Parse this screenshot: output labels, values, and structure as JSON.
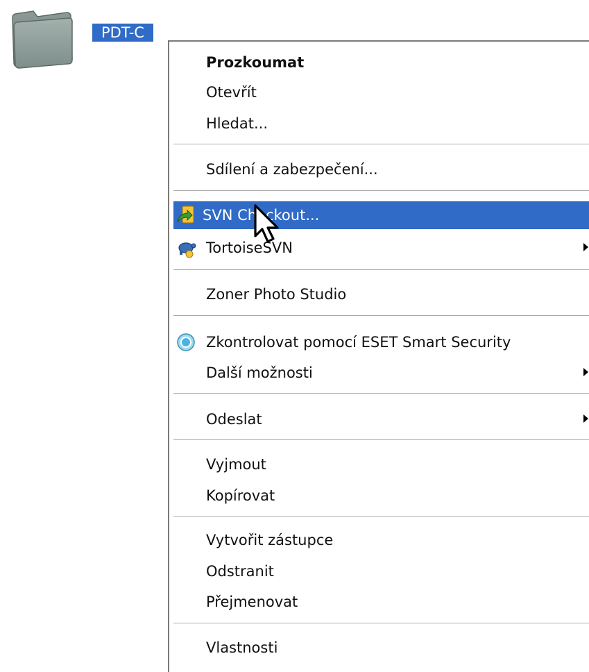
{
  "desktop": {
    "folder_icon": "folder-icon",
    "folder_name": "PDT-C",
    "selection_color": "#2f6bc7"
  },
  "menu": {
    "highlight_color": "#2f6bc7",
    "items": [
      {
        "label": "Prozkoumat",
        "bold": true
      },
      {
        "label": "Otevřít"
      },
      {
        "label": "Hledat..."
      },
      {
        "label": "Sdílení a zabezpečení..."
      },
      {
        "label": "SVN Checkout...",
        "icon": "svn-checkout-icon",
        "highlighted": true
      },
      {
        "label": "TortoiseSVN",
        "icon": "tortoisesvn-icon",
        "submenu": true
      },
      {
        "label": "Zoner Photo Studio"
      },
      {
        "label": "Zkontrolovat pomocí ESET Smart Security",
        "icon": "eset-icon"
      },
      {
        "label": "Další možnosti",
        "submenu": true
      },
      {
        "label": "Odeslat",
        "submenu": true
      },
      {
        "label": "Vyjmout"
      },
      {
        "label": "Kopírovat"
      },
      {
        "label": "Vytvořit zástupce"
      },
      {
        "label": "Odstranit"
      },
      {
        "label": "Přejmenovat"
      },
      {
        "label": "Vlastnosti"
      }
    ],
    "submenu_arrow_icon": "submenu-arrow-icon"
  },
  "cursor_icon": "mouse-pointer-icon"
}
